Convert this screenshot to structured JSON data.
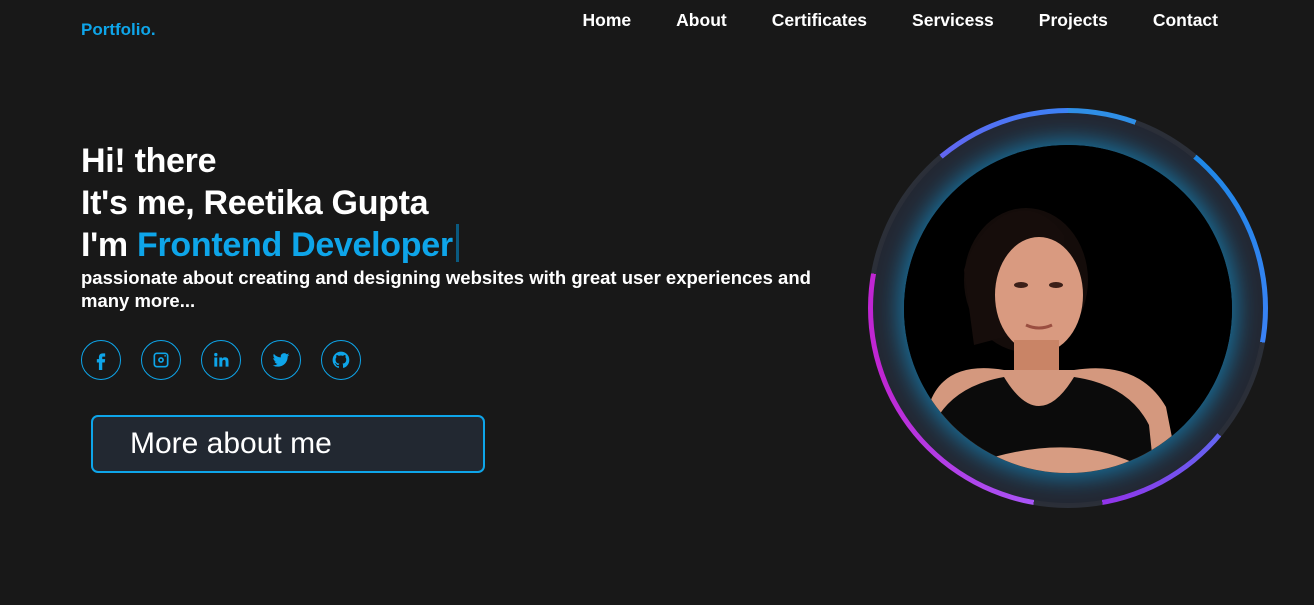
{
  "logo": "Portfolio.",
  "nav": {
    "items": [
      "Home",
      "About",
      "Certificates",
      "Servicess",
      "Projects",
      "Contact"
    ]
  },
  "hero": {
    "line1": "Hi! there",
    "line2": "It's me, Reetika Gupta",
    "line3_prefix": "I'm ",
    "role": "Frontend Developer",
    "description": "passionate about creating and designing websites with great user experiences and many more..."
  },
  "socials": [
    "facebook-icon",
    "instagram-icon",
    "linkedin-icon",
    "twitter-icon",
    "github-icon"
  ],
  "cta": {
    "label": "More about me"
  },
  "colors": {
    "background": "#181818",
    "accent": "#0ea5e9",
    "button_bg": "#222831"
  }
}
